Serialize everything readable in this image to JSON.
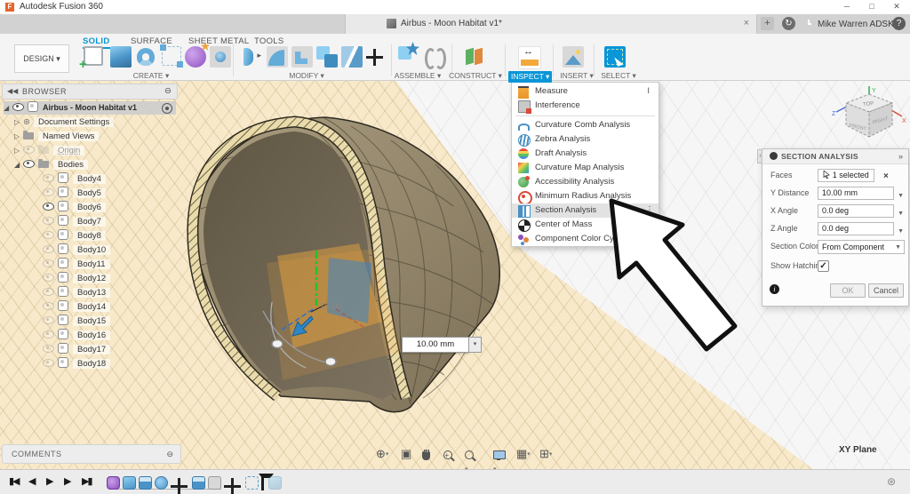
{
  "window": {
    "app_title": "Autodesk Fusion 360",
    "minimize": "─",
    "maximize": "□",
    "close": "✕",
    "document_tab": "Airbus - Moon Habitat v1*",
    "tab_close": "×",
    "new_tab": "+",
    "user": "Mike Warren ADSK",
    "help": "?"
  },
  "ribbon": {
    "design_menu": "DESIGN ▾",
    "tabs": [
      "SOLID",
      "SURFACE",
      "SHEET METAL",
      "TOOLS"
    ],
    "active_tab": "SOLID",
    "groups": [
      "CREATE ▾",
      "MODIFY ▾",
      "ASSEMBLE ▾",
      "CONSTRUCT ▾",
      "INSPECT ▾",
      "INSERT ▾",
      "SELECT ▾"
    ]
  },
  "inspect_menu": {
    "items": [
      {
        "label": "Measure",
        "shortcut": "I"
      },
      {
        "label": "Interference",
        "shortcut": ""
      },
      {
        "label": "Curvature Comb Analysis",
        "shortcut": ""
      },
      {
        "label": "Zebra Analysis",
        "shortcut": ""
      },
      {
        "label": "Draft Analysis",
        "shortcut": ""
      },
      {
        "label": "Curvature Map Analysis",
        "shortcut": ""
      },
      {
        "label": "Accessibility Analysis",
        "shortcut": ""
      },
      {
        "label": "Minimum Radius Analysis",
        "shortcut": ""
      },
      {
        "label": "Section Analysis",
        "shortcut": "",
        "highlighted": true
      },
      {
        "label": "Center of Mass",
        "shortcut": ""
      },
      {
        "label": "Component Color Cycling Toggle",
        "shortcut": "Shift+"
      }
    ]
  },
  "browser": {
    "header": "BROWSER",
    "root": "Airbus - Moon Habitat v1",
    "items": [
      "Document Settings",
      "Named Views",
      "Origin",
      "Bodies"
    ],
    "bodies": [
      {
        "name": "Body4",
        "visible": false
      },
      {
        "name": "Body5",
        "visible": false
      },
      {
        "name": "Body6",
        "visible": true
      },
      {
        "name": "Body7",
        "visible": false
      },
      {
        "name": "Body8",
        "visible": false
      },
      {
        "name": "Body10",
        "visible": false
      },
      {
        "name": "Body11",
        "visible": false
      },
      {
        "name": "Body12",
        "visible": false
      },
      {
        "name": "Body13",
        "visible": false
      },
      {
        "name": "Body14",
        "visible": false
      },
      {
        "name": "Body15",
        "visible": false
      },
      {
        "name": "Body16",
        "visible": false
      },
      {
        "name": "Body17",
        "visible": false
      },
      {
        "name": "Body18",
        "visible": false
      }
    ]
  },
  "section_dialog": {
    "title": "SECTION ANALYSIS",
    "faces_label": "Faces",
    "faces_value": "1 selected",
    "clear_selection": "×",
    "rows": [
      {
        "label": "Y Distance",
        "value": "10.00 mm"
      },
      {
        "label": "X Angle",
        "value": "0.0 deg"
      },
      {
        "label": "Z Angle",
        "value": "0.0 deg"
      },
      {
        "label": "Section Color",
        "value": "From Component"
      }
    ],
    "hatching_label": "Show Hatching",
    "hatching_checked": true,
    "check_glyph": "✓",
    "ok": "OK",
    "cancel": "Cancel"
  },
  "viewport": {
    "distance_input": "10.00 mm",
    "manipulator_value": "10.00",
    "plane_tooltip": "XY Plane",
    "viewcube": {
      "top": "TOP",
      "front": "FRONT",
      "right": "RIGHT",
      "axis_x": "X",
      "axis_y": "Y",
      "axis_z": "Z"
    }
  },
  "comments": {
    "label": "COMMENTS"
  },
  "colors": {
    "accent": "#0a96d7",
    "plane_highlight": "#f7e9ca",
    "dome_outer": "#96896c",
    "dome_inner": "#6b6250",
    "hatch_fill": "#eadbab",
    "manip_orange": "#f2a93c",
    "manip_blue": "#3c85c6",
    "axis_green": "#21c321"
  }
}
